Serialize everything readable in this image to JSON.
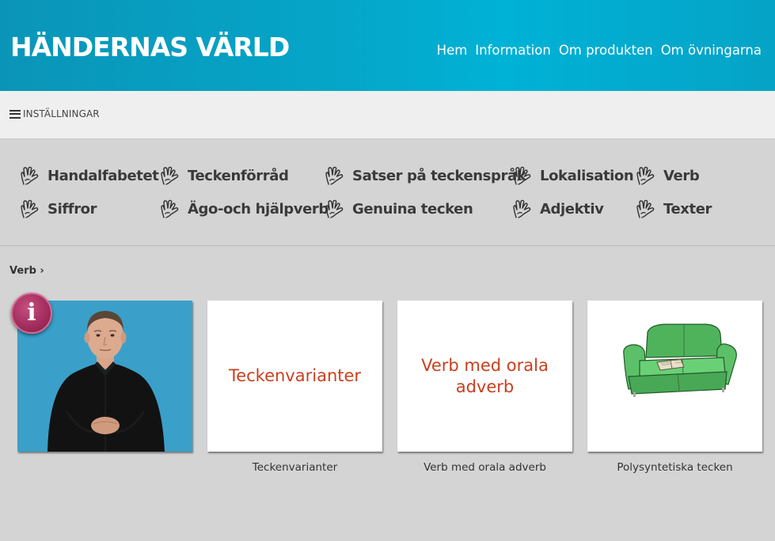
{
  "header": {
    "site_title": "HÄNDERNAS VÄRLD",
    "nav": [
      "Hem",
      "Information",
      "Om produkten",
      "Om övningarna"
    ]
  },
  "settings": {
    "label": "INSTÄLLNINGAR",
    "icon": "hamburger-menu-icon"
  },
  "categories": [
    {
      "label": "Handalfabetet",
      "icon": "hand-sign-icon"
    },
    {
      "label": "Teckenförråd",
      "icon": "hand-sign-icon"
    },
    {
      "label": "Satser på teckenspråk",
      "icon": "hand-sign-icon"
    },
    {
      "label": "Lokalisation",
      "icon": "hand-sign-icon"
    },
    {
      "label": "Verb",
      "icon": "hand-sign-icon"
    },
    {
      "label": "Siffror",
      "icon": "hand-sign-icon"
    },
    {
      "label": "Ägo-och hjälpverb",
      "icon": "hand-sign-icon"
    },
    {
      "label": "Genuina tecken",
      "icon": "hand-sign-icon"
    },
    {
      "label": "Adjektiv",
      "icon": "hand-sign-icon"
    },
    {
      "label": "Texter",
      "icon": "hand-sign-icon"
    }
  ],
  "breadcrumb": "Verb ›",
  "info_badge": "i",
  "cards": [
    {
      "type": "video",
      "caption": ""
    },
    {
      "type": "text",
      "text": "Teckenvarianter",
      "caption": "Teckenvarianter"
    },
    {
      "type": "text",
      "text": "Verb med orala adverb",
      "caption": "Verb med orala adverb"
    },
    {
      "type": "image",
      "image": "green-sofa-with-book",
      "caption": "Polysyntetiska tecken"
    }
  ],
  "colors": {
    "header": "#05a6c9",
    "card_text": "#c8401e",
    "info_badge": "#a02c5c",
    "video_bg": "#3aa0c9",
    "sofa": "#4caf57"
  }
}
